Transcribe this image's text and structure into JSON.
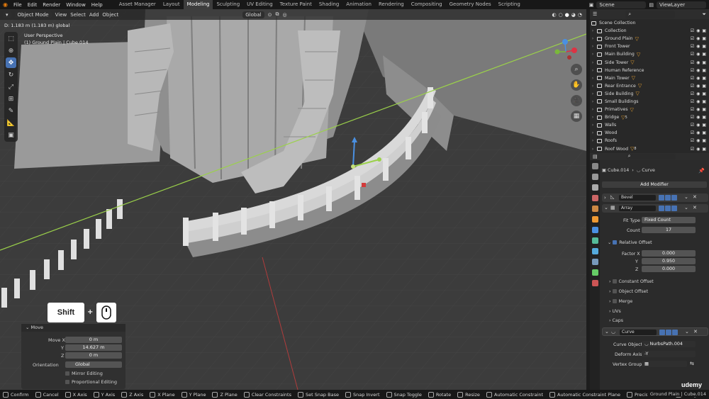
{
  "menu": [
    "File",
    "Edit",
    "Render",
    "Window",
    "Help"
  ],
  "workspaces": [
    "Asset Manager",
    "Layout",
    "Modeling",
    "Sculpting",
    "UV Editing",
    "Texture Paint",
    "Shading",
    "Animation",
    "Rendering",
    "Compositing",
    "Geometry Nodes",
    "Scripting"
  ],
  "active_workspace": "Modeling",
  "scene": "Scene",
  "view_layer": "ViewLayer",
  "viewport": {
    "mode": "Object Mode",
    "menus": [
      "View",
      "Select",
      "Add",
      "Object"
    ],
    "orientation": "Global",
    "distance": "D: 1.183 m (1.183 m) global",
    "perspective": "User Perspective",
    "context": "(1) Ground Plain | Cube.014"
  },
  "keyhint": {
    "key": "Shift",
    "plus": "+"
  },
  "op_panel": {
    "title": "Move",
    "move_x_label": "Move X",
    "move_x": "0 m",
    "y_label": "Y",
    "y": "14.627 m",
    "z_label": "Z",
    "z": "0 m",
    "orientation_label": "Orientation",
    "orientation": "Global",
    "mirror": "Mirror Editing",
    "proportional": "Proportional Editing"
  },
  "statusbar": [
    "Confirm",
    "Cancel",
    "X Axis",
    "Y Axis",
    "Z Axis",
    "X Plane",
    "Y Plane",
    "Z Plane",
    "Clear Constraints",
    "Set Snap Base",
    "Snap Invert",
    "Snap Toggle",
    "Rotate",
    "Resize",
    "Automatic Constraint",
    "Automatic Constraint Plane",
    "Precision Mode",
    "Navigate"
  ],
  "statusbar_right": "Ground Plain | Cube.014",
  "watermark": "udemy",
  "outliner": {
    "search_placeholder": "",
    "root": "Scene Collection",
    "items": [
      "Collection",
      "Ground Plain",
      "Front Tower",
      "Main Building",
      "Side Tower",
      "Human Reference",
      "Main Tower",
      "Rear Entrance",
      "Side Building",
      "Small Buildings",
      "Primatives",
      "Bridge",
      "Walls",
      "Wood",
      "Roofs",
      "Roof Wood"
    ],
    "filter_counts": [
      "",
      "",
      "",
      "",
      "",
      "",
      "",
      "",
      "",
      "",
      "",
      "5",
      "4",
      "",
      "",
      "8"
    ]
  },
  "properties": {
    "object": "Cube.014",
    "data": "Curve",
    "add_modifier": "Add Modifier",
    "bevel": "Bevel",
    "array": "Array",
    "fit_type_label": "Fit Type",
    "fit_type": "Fixed Count",
    "count_label": "Count",
    "count": "17",
    "relative_offset": "Relative Offset",
    "factor_x_label": "Factor X",
    "factor_x": "0.000",
    "factor_y_label": "Y",
    "factor_y": "0.950",
    "factor_z_label": "Z",
    "factor_z": "0.000",
    "constant_offset": "Constant Offset",
    "object_offset": "Object Offset",
    "merge": "Merge",
    "uvs": "UVs",
    "caps": "Caps",
    "curve": "Curve",
    "curve_object_label": "Curve Object",
    "curve_object": "NurbsPath.004",
    "deform_axis_label": "Deform Axis",
    "deform_axis": "-Y",
    "vertex_group_label": "Vertex Group"
  }
}
